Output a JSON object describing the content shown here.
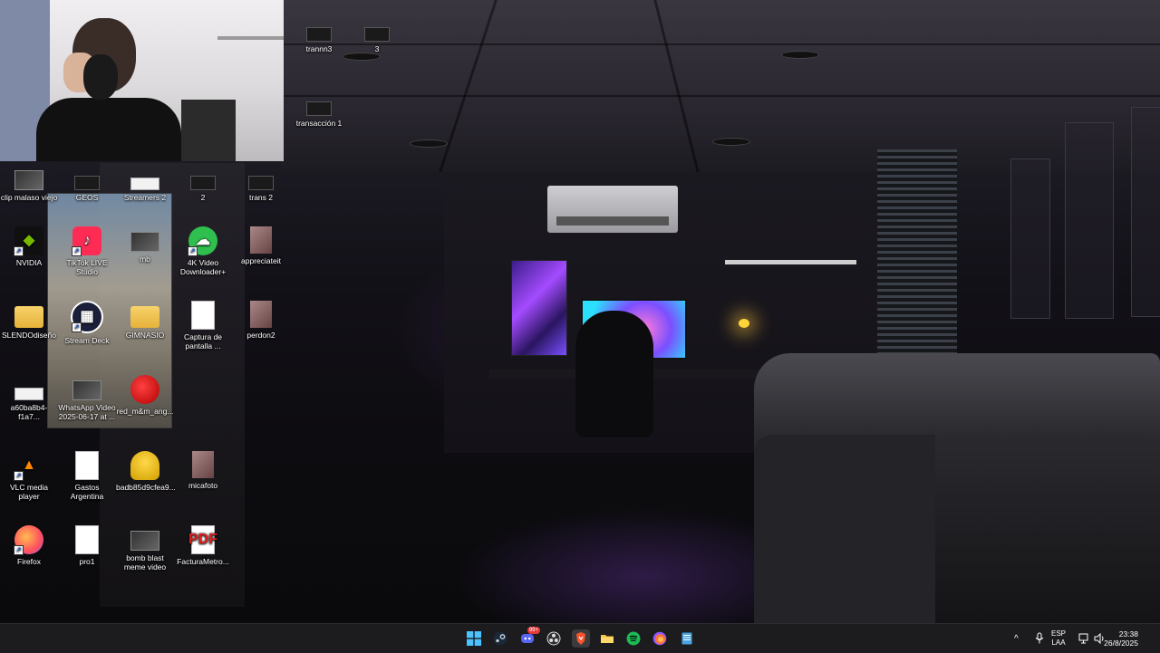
{
  "desktop": {
    "icons": [
      {
        "id": "trannn3",
        "label": "trannn3",
        "glyph": "blank-thumbnail"
      },
      {
        "id": "3",
        "label": "3",
        "glyph": "blank-thumbnail"
      },
      {
        "id": "transaccion1",
        "label": "transacción 1",
        "glyph": "blank-thumbnail"
      },
      {
        "id": "clip",
        "label": "clip malaso viejo",
        "glyph": "video-thumbnail"
      },
      {
        "id": "geos",
        "label": "GEOS",
        "glyph": "blank-thumbnail"
      },
      {
        "id": "streamers2",
        "label": "Streamers 2",
        "glyph": "white-thumbnail"
      },
      {
        "id": "2",
        "label": "2",
        "glyph": "blank-thumbnail"
      },
      {
        "id": "trans2",
        "label": "trans 2",
        "glyph": "blank-thumbnail"
      },
      {
        "id": "nvidia",
        "label": "NVIDIA",
        "glyph": "nvidia-icon"
      },
      {
        "id": "tiktok",
        "label": "TikTok LIVE Studio",
        "glyph": "tiktok-icon"
      },
      {
        "id": "mb",
        "label": "mb",
        "glyph": "video-thumbnail"
      },
      {
        "id": "4k",
        "label": "4K Video Downloader+",
        "glyph": "4k-downloader-icon"
      },
      {
        "id": "appreciateit",
        "label": "appreciateit",
        "glyph": "photo-thumbnail"
      },
      {
        "id": "slendo",
        "label": "SLENDOdiseño",
        "glyph": "folder-icon"
      },
      {
        "id": "streamdeck",
        "label": "Stream Deck",
        "glyph": "stream-deck-icon"
      },
      {
        "id": "gimnasio",
        "label": "GIMNASIO",
        "glyph": "folder-icon"
      },
      {
        "id": "captura",
        "label": "Captura de pantalla ...",
        "glyph": "document-icon"
      },
      {
        "id": "perdon2",
        "label": "perdon2",
        "glyph": "photo-thumbnail"
      },
      {
        "id": "a60b",
        "label": "a60ba8b4-f1a7...",
        "glyph": "white-thumbnail"
      },
      {
        "id": "whatsapp",
        "label": "WhatsApp Video 2025-06-17 at ...",
        "glyph": "video-thumbnail"
      },
      {
        "id": "redmm",
        "label": "red_m&m_ang...",
        "glyph": "mm-icon"
      },
      {
        "id": "vlc",
        "label": "VLC media player",
        "glyph": "vlc-icon"
      },
      {
        "id": "gastos",
        "label": "Gastos Argentina",
        "glyph": "document-icon"
      },
      {
        "id": "badb",
        "label": "badb85d9cfea9...",
        "glyph": "helmet-icon"
      },
      {
        "id": "micafoto",
        "label": "micafoto",
        "glyph": "photo-thumbnail"
      },
      {
        "id": "firefox",
        "label": "Firefox",
        "glyph": "firefox-icon"
      },
      {
        "id": "pro1",
        "label": "pro1",
        "glyph": "document-icon"
      },
      {
        "id": "bombblast",
        "label": "bomb blast meme video",
        "glyph": "video-thumbnail"
      },
      {
        "id": "factura",
        "label": "FacturaMetro...",
        "glyph": "pdf-icon"
      }
    ]
  },
  "taskbar": {
    "apps": [
      {
        "name": "start",
        "icon": "windows-icon"
      },
      {
        "name": "steam",
        "icon": "steam-icon"
      },
      {
        "name": "discord",
        "icon": "discord-icon",
        "badge": "99+"
      },
      {
        "name": "obs",
        "icon": "obs-icon"
      },
      {
        "name": "brave",
        "icon": "brave-icon"
      },
      {
        "name": "file-explorer",
        "icon": "folder-icon"
      },
      {
        "name": "spotify",
        "icon": "spotify-icon"
      },
      {
        "name": "firefox",
        "icon": "firefox-icon"
      },
      {
        "name": "notepad",
        "icon": "notepad-icon"
      }
    ],
    "tray": {
      "language_top": "ESP",
      "language_bottom": "LAA",
      "time": "23:38",
      "date": "26/8/2025"
    }
  },
  "colors": {
    "taskbar": "#1c1c1f",
    "accent": "#0078d4"
  }
}
